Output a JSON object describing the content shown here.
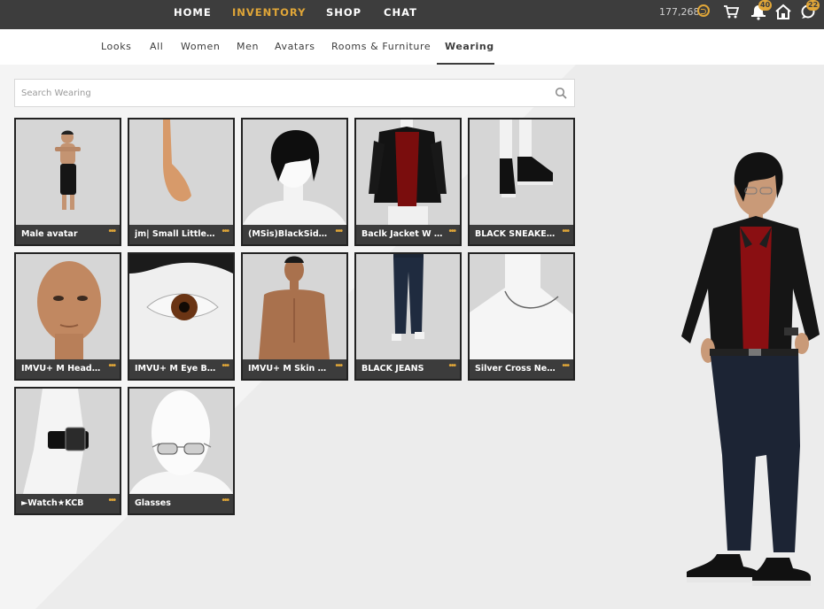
{
  "topnav": {
    "items": [
      "HOME",
      "INVENTORY",
      "SHOP",
      "CHAT"
    ],
    "active_index": 1
  },
  "status": {
    "credits": "177,268",
    "notifications_badge": "40",
    "chat_badge": "22"
  },
  "subnav": {
    "items": [
      "Looks",
      "All",
      "Women",
      "Men",
      "Avatars",
      "Rooms & Furniture",
      "Wearing"
    ],
    "active_index": 6
  },
  "search": {
    "placeholder": "Search Wearing",
    "value": ""
  },
  "items": [
    {
      "name": "Male avatar",
      "thumb": "male-avatar-thumb"
    },
    {
      "name": "jm| Small Little Hands",
      "thumb": "hand-thumb"
    },
    {
      "name": "(MSis)BlackSideBangs",
      "thumb": "hair-thumb"
    },
    {
      "name": "Baclk Jacket W Red Shirt",
      "thumb": "jacket-thumb"
    },
    {
      "name": "BLACK SNEAKERS",
      "thumb": "sneakers-thumb"
    },
    {
      "name": "IMVU+ M Head Skin",
      "thumb": "head-thumb"
    },
    {
      "name": "IMVU+ M Eye Brown",
      "thumb": "eye-thumb"
    },
    {
      "name": "IMVU+ M Skin Olive",
      "thumb": "skin-thumb"
    },
    {
      "name": "BLACK JEANS",
      "thumb": "jeans-thumb"
    },
    {
      "name": "Silver Cross Necklace",
      "thumb": "necklace-thumb"
    },
    {
      "name": "►Watch★KCB",
      "thumb": "watch-thumb"
    },
    {
      "name": "Glasses",
      "thumb": "glasses-thumb"
    }
  ],
  "more_label": "•••",
  "colors": {
    "topbar": "#3d3d3d",
    "accent": "#e0a638",
    "caption": "#3c3c3c"
  }
}
